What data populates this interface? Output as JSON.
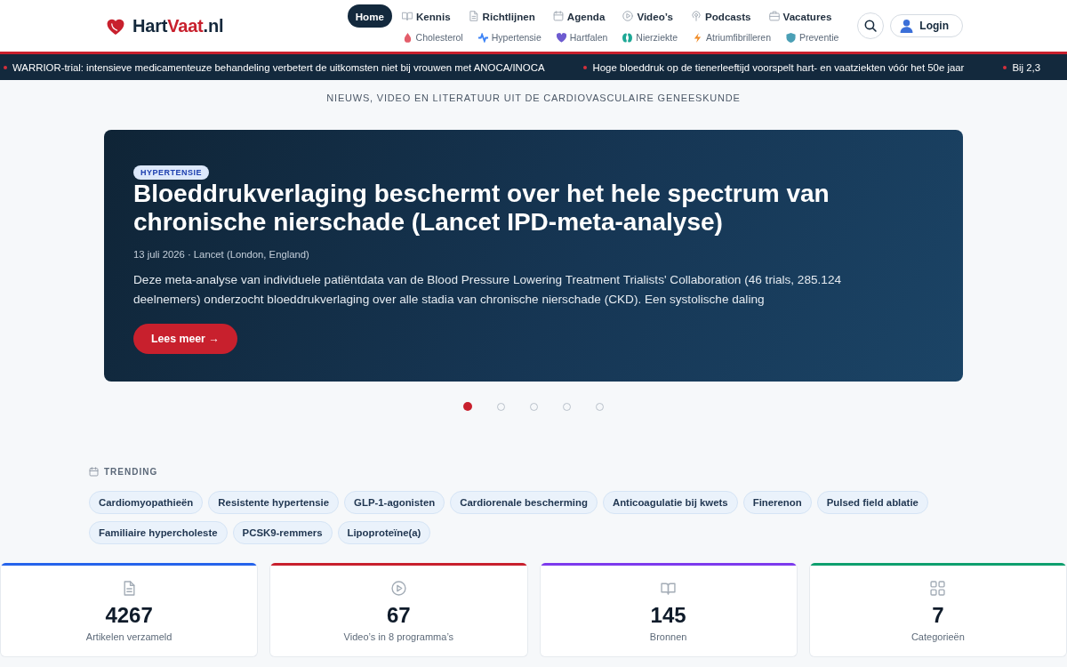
{
  "header": {
    "logo": {
      "name": "Hart",
      "accent": "Vaat",
      "domain": ".nl"
    },
    "nav": [
      {
        "label": "Home",
        "selected": true
      },
      {
        "label": "Kennis",
        "selected": false
      },
      {
        "label": "Richtlijnen",
        "selected": false
      },
      {
        "label": "Agenda",
        "selected": false
      },
      {
        "label": "Video’s",
        "selected": false
      },
      {
        "label": "Podcasts",
        "selected": false
      },
      {
        "label": "Vacatures",
        "selected": false
      }
    ],
    "topics": [
      {
        "label": "Cholesterol",
        "color": "#e35d6a"
      },
      {
        "label": "Hypertensie",
        "color": "#3b82f6"
      },
      {
        "label": "Hartfalen",
        "color": "#6d5bd0"
      },
      {
        "label": "Nierziekte",
        "color": "#1ea896"
      },
      {
        "label": "Atriumfibrilleren",
        "color": "#f08a24"
      },
      {
        "label": "Preventie",
        "color": "#4a9fb5"
      }
    ],
    "login_button": "Login"
  },
  "ticker": [
    "WARRIOR-trial: intensieve medicamenteuze behandeling verbetert de uitkomsten niet bij vrouwen met ANOCA/INOCA",
    "Hoge bloeddruk op de tienerleeftijd voorspelt hart- en vaatziekten vóór het 50e jaar",
    "Bij 2,3"
  ],
  "tagline": "NIEUWS, VIDEO EN LITERATUUR UIT DE CARDIOVASCULAIRE GENEESKUNDE",
  "hero": {
    "category": "HYPERTENSIE",
    "title": "Bloeddrukverlaging beschermt over het hele spectrum van chronische nierschade (Lancet IPD-meta-analyse)",
    "meta": "13 juli 2026 · Lancet (London, England)",
    "summary": "Deze meta-analyse van individuele patiëntdata van de Blood Pressure Lowering Treatment Trialists' Collaboration (46 trials, 285.124 deelnemers) onderzocht bloeddrukverlaging over alle stadia van chronische nierschade (CKD). Een systolische daling",
    "button": "Lees meer →",
    "dots": [
      {
        "selected": true
      },
      {
        "selected": false
      },
      {
        "selected": false
      },
      {
        "selected": false
      },
      {
        "selected": false
      }
    ]
  },
  "trending": {
    "title": "TRENDING",
    "tags": [
      "Cardiomyopathieën",
      "Resistente hypertensie",
      "GLP-1-agonisten",
      "Cardiorenale bescherming",
      "Anticoagulatie bij kwets",
      "Finerenon",
      "Pulsed field ablatie",
      "Familiaire hypercholeste",
      "PCSK9-remmers",
      "Lipoproteïne(a)"
    ]
  },
  "stats": [
    {
      "value": "4267",
      "label": "Artikelen verzameld",
      "color": "#2563eb"
    },
    {
      "value": "67",
      "label": "Video’s in 8 programma’s",
      "color": "#c8202d"
    },
    {
      "value": "145",
      "label": "Bronnen",
      "color": "#7c3aed"
    },
    {
      "value": "7",
      "label": "Categorieën",
      "color": "#0e9f6e"
    }
  ]
}
